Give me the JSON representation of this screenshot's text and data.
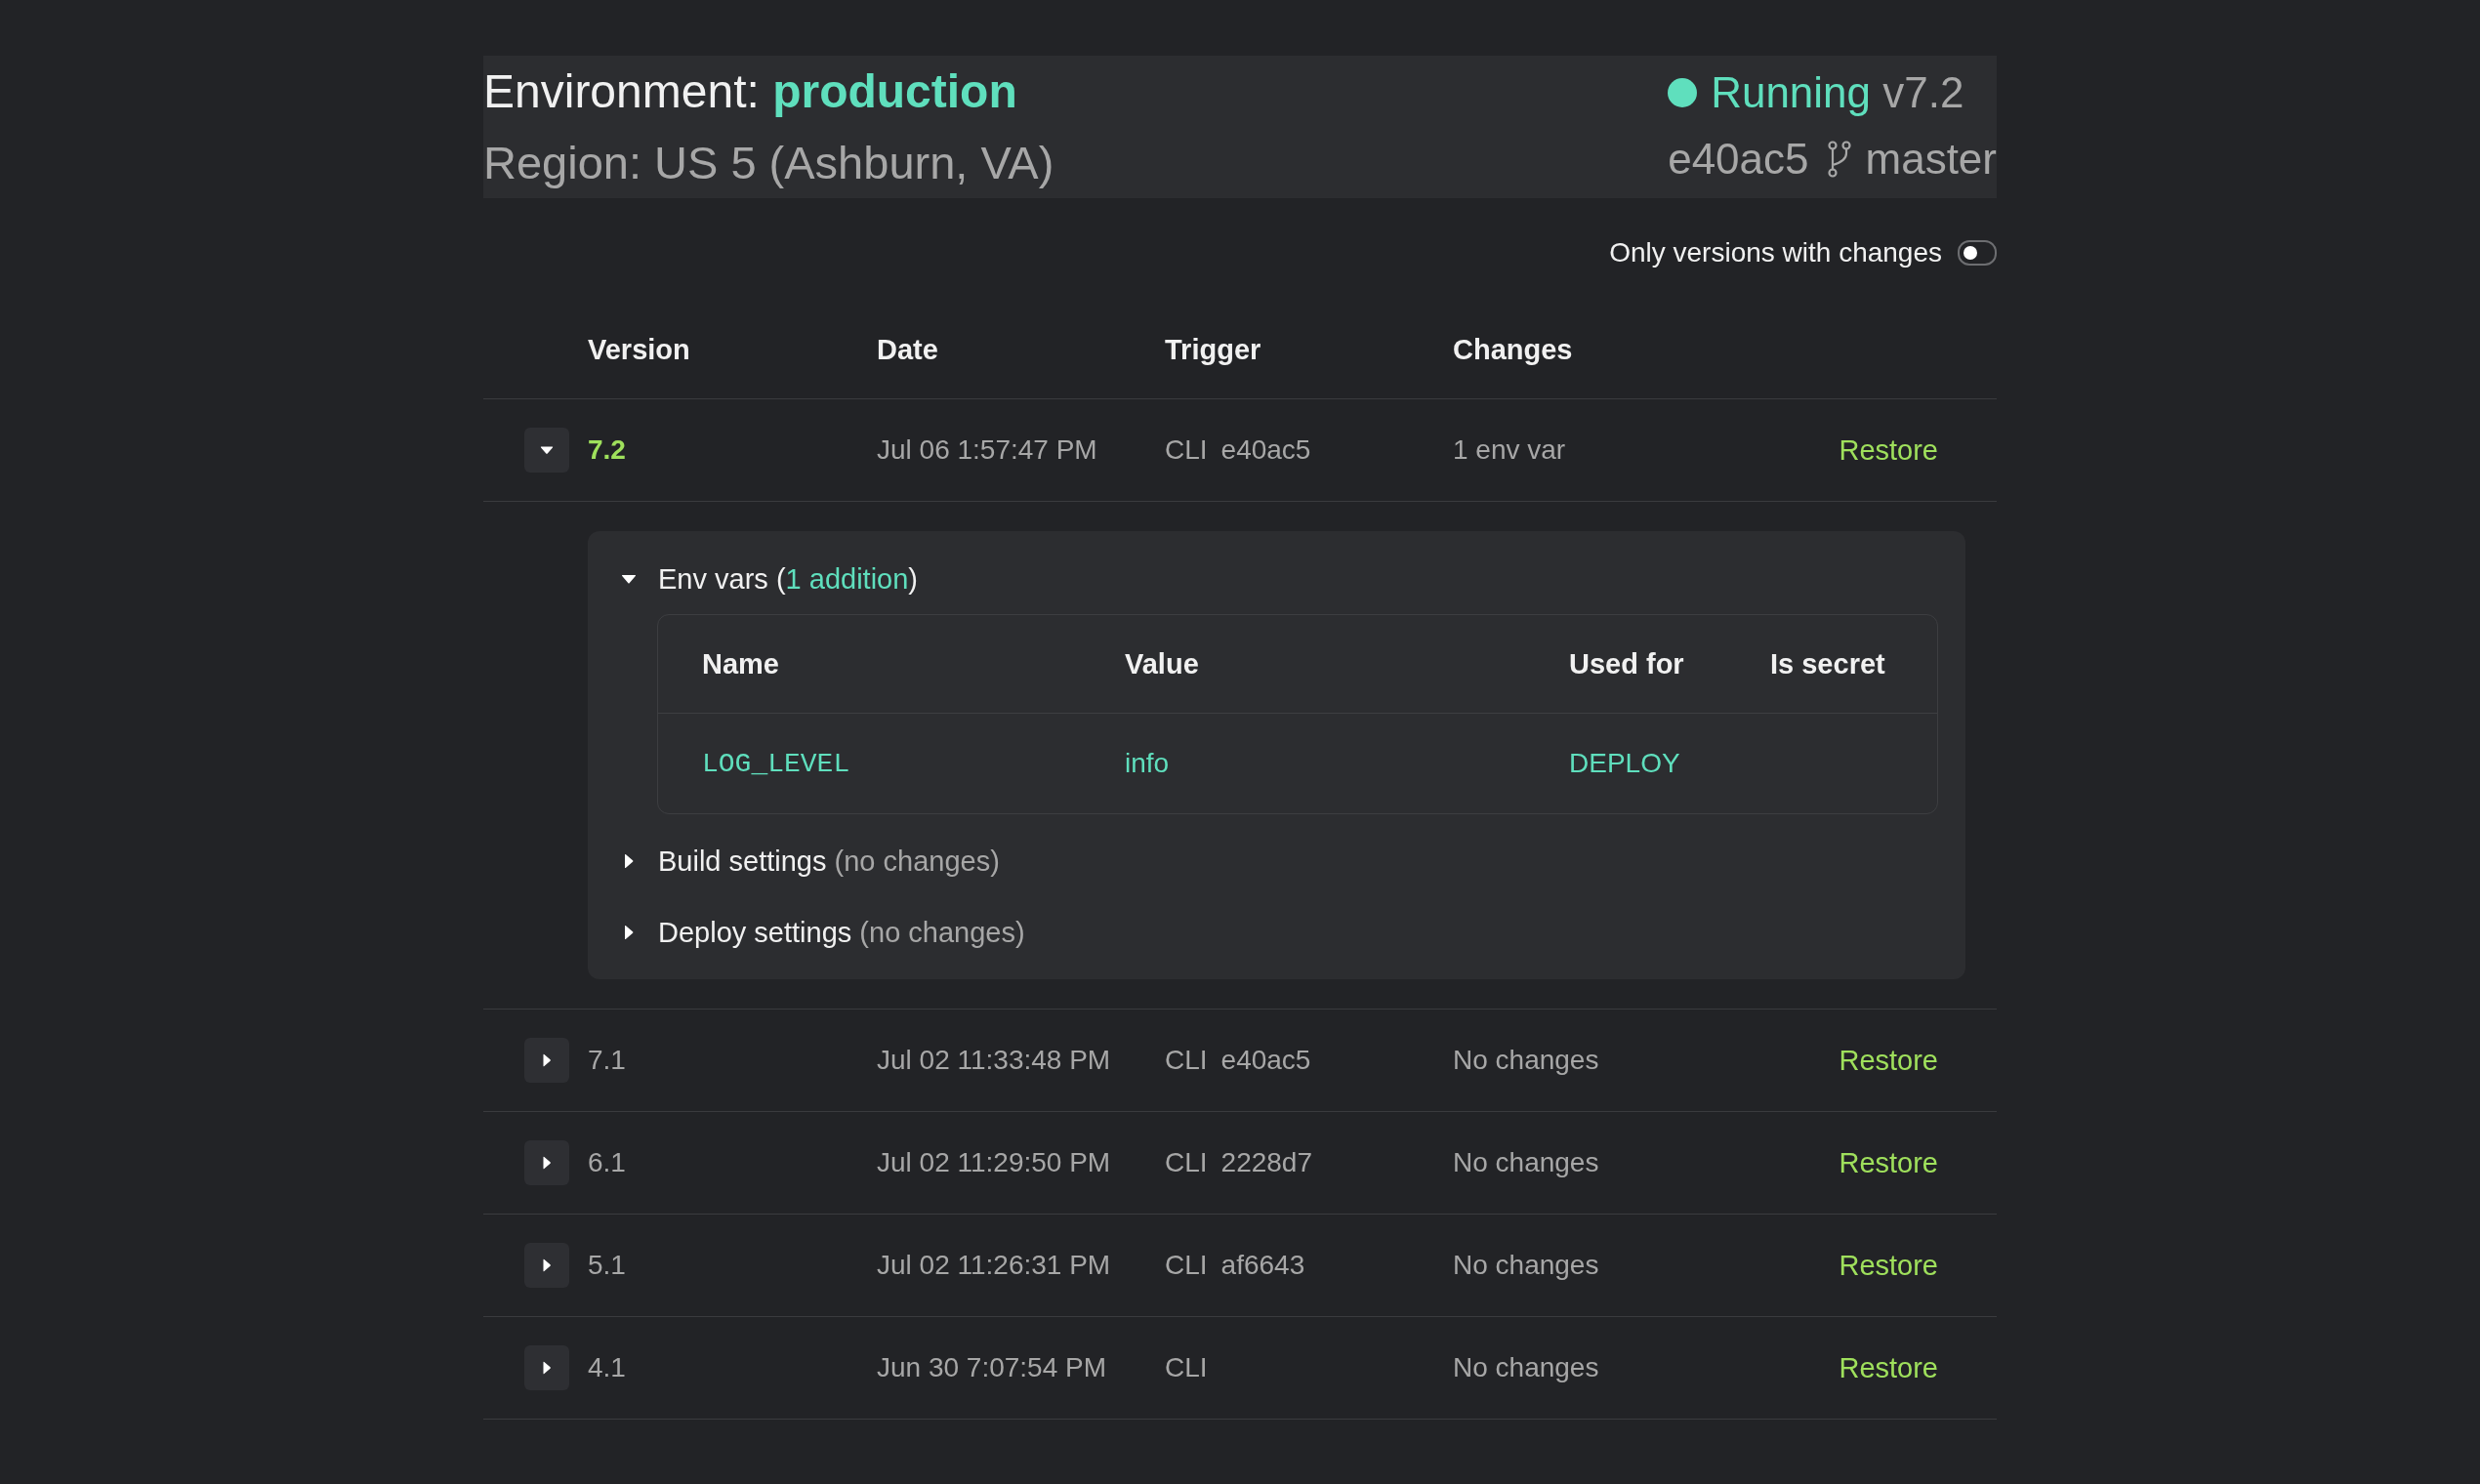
{
  "environment": {
    "label": "Environment:",
    "name": "production",
    "region": "Region: US 5 (Ashburn, VA)"
  },
  "status": {
    "state": "Running",
    "version": "v7.2",
    "commit": "e40ac5",
    "branch": "master"
  },
  "filter_toggle": {
    "label": "Only versions with changes",
    "on": false
  },
  "versions": {
    "columns": [
      "Version",
      "Date",
      "Trigger",
      "Changes"
    ],
    "rows": [
      {
        "version": "7.2",
        "current": true,
        "expanded": true,
        "date": "Jul 06 1:57:47 PM",
        "trigger": "CLI",
        "commit": "e40ac5",
        "changes": "1 env var",
        "action": "Restore",
        "details": {
          "sections": [
            {
              "title": "Env vars",
              "summary": [
                {
                  "text": "(",
                  "kind": "plain"
                },
                {
                  "text": "1 addition",
                  "kind": "count"
                },
                {
                  "text": ")",
                  "kind": "plain"
                }
              ],
              "expanded": true,
              "table": {
                "columns": [
                  "Name",
                  "Value",
                  "Used for",
                  "Is secret"
                ],
                "rows": [
                  {
                    "name": "LOG_LEVEL",
                    "value": "info",
                    "used_for": "DEPLOY"
                  }
                ]
              }
            },
            {
              "title": "Build settings",
              "summary": [
                {
                  "text": "(no changes)",
                  "kind": "muted"
                }
              ],
              "expanded": false
            },
            {
              "title": "Deploy settings",
              "summary": [
                {
                  "text": "(no changes)",
                  "kind": "muted"
                }
              ],
              "expanded": false
            }
          ]
        }
      },
      {
        "version": "7.1",
        "current": false,
        "expanded": false,
        "date": "Jul 02 11:33:48 PM",
        "trigger": "CLI",
        "commit": "e40ac5",
        "changes": "No changes",
        "action": "Restore"
      },
      {
        "version": "6.1",
        "current": false,
        "expanded": false,
        "date": "Jul 02 11:29:50 PM",
        "trigger": "CLI",
        "commit": "2228d7",
        "changes": "No changes",
        "action": "Restore"
      },
      {
        "version": "5.1",
        "current": false,
        "expanded": false,
        "date": "Jul 02 11:26:31 PM",
        "trigger": "CLI",
        "commit": "af6643",
        "changes": "No changes",
        "action": "Restore"
      },
      {
        "version": "4.1",
        "current": false,
        "expanded": false,
        "date": "Jun 30 7:07:54 PM",
        "trigger": "CLI",
        "changes": "No changes",
        "action": "Restore"
      }
    ]
  }
}
